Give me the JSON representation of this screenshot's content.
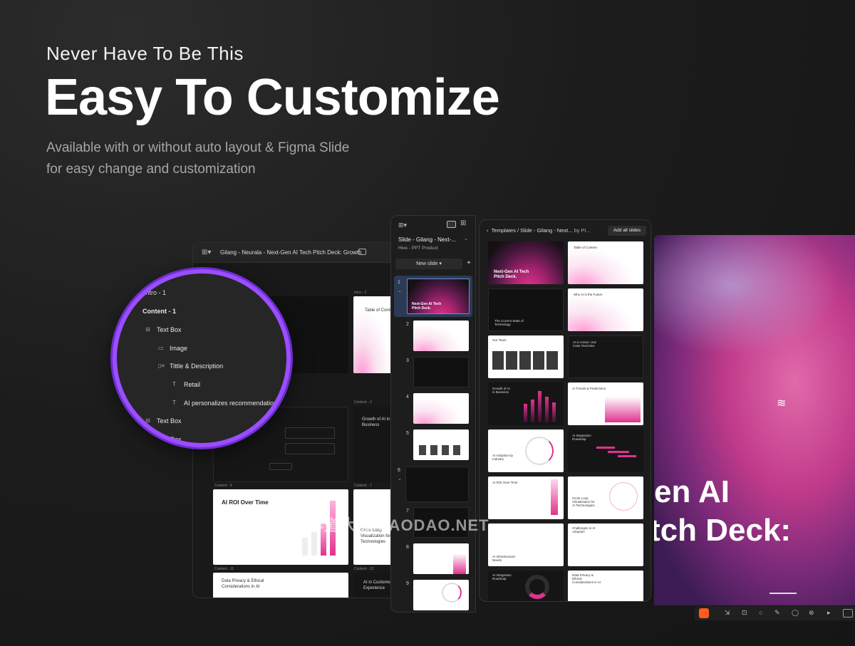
{
  "hero": {
    "subtitle": "Never Have To Be This",
    "title": "Easy To Customize",
    "description_line1": "Available with or without auto layout  & Figma Slide",
    "description_line2": "for easy change and customization"
  },
  "deck_window": {
    "title": "Gilang - Neurala - Next-Gen AI Tech Pitch Deck: Growth For...",
    "labels": {
      "intro2": "Intro - 2",
      "content2": "Content - 2",
      "content6": "Content - 6",
      "content7": "Content - 7",
      "content11": "Content - 11",
      "content12": "Content - 12"
    },
    "slides": {
      "intro2_title": "Table of Conte",
      "content2_title": "Growth of AI in Business",
      "content6_title": "AI ROI Over Time",
      "content7_title": "Circle Loop Visualization for Technologies",
      "content11_title": "Data Privacy & Ethical Considerations in AI",
      "content12_title": "AI in Customer Experience"
    }
  },
  "magnifier": {
    "items": [
      "Intro - 1",
      "Content - 1",
      "Text Box",
      "Image",
      "Tittle & Description",
      "Retail",
      "AI personalizes recommendations",
      "Text Box",
      "Text Box"
    ]
  },
  "slides_window": {
    "title": "Slide - Gilang - Next-...",
    "subtitle": "Hive - PPT Product",
    "new_slide": "New slide",
    "numbers": [
      "1",
      "2",
      "3",
      "4",
      "5",
      "6",
      "7",
      "8",
      "9"
    ],
    "first_slide_title": "Next-Gen AI Tech Pitch Deck."
  },
  "templates_window": {
    "breadcrumb": "Templates / Slide - Gilang - Next...",
    "by": "by Pi...",
    "add_all": "Add all slides",
    "cards": [
      "Next-Gen AI Tech Pitch Deck.",
      "Table of Content",
      "The Current State of Technology",
      "Why AI is the Future",
      "Our Team",
      "AI in Action: Use Case Overview",
      "Growth of AI in Business",
      "AI Trends & Predictions",
      "AI Adoption by Industry",
      "AI Integration Roadmap",
      "AI ROI Over Time",
      "Circle Loop Visualization for AI Technologies",
      "AI Infrastructure Needs",
      "Challenges in AI Adoption",
      "AI Integration Roadmap",
      "Data Privacy & Ethical Considerations in AI"
    ]
  },
  "preview": {
    "line1": "en AI",
    "line2": "tch Deck:"
  },
  "watermark": "早道大咖  ZAODAO.NET",
  "colors": {
    "accent_purple": "#9b4dff",
    "magenta": "#e0328e",
    "background": "#1c1c1c"
  }
}
